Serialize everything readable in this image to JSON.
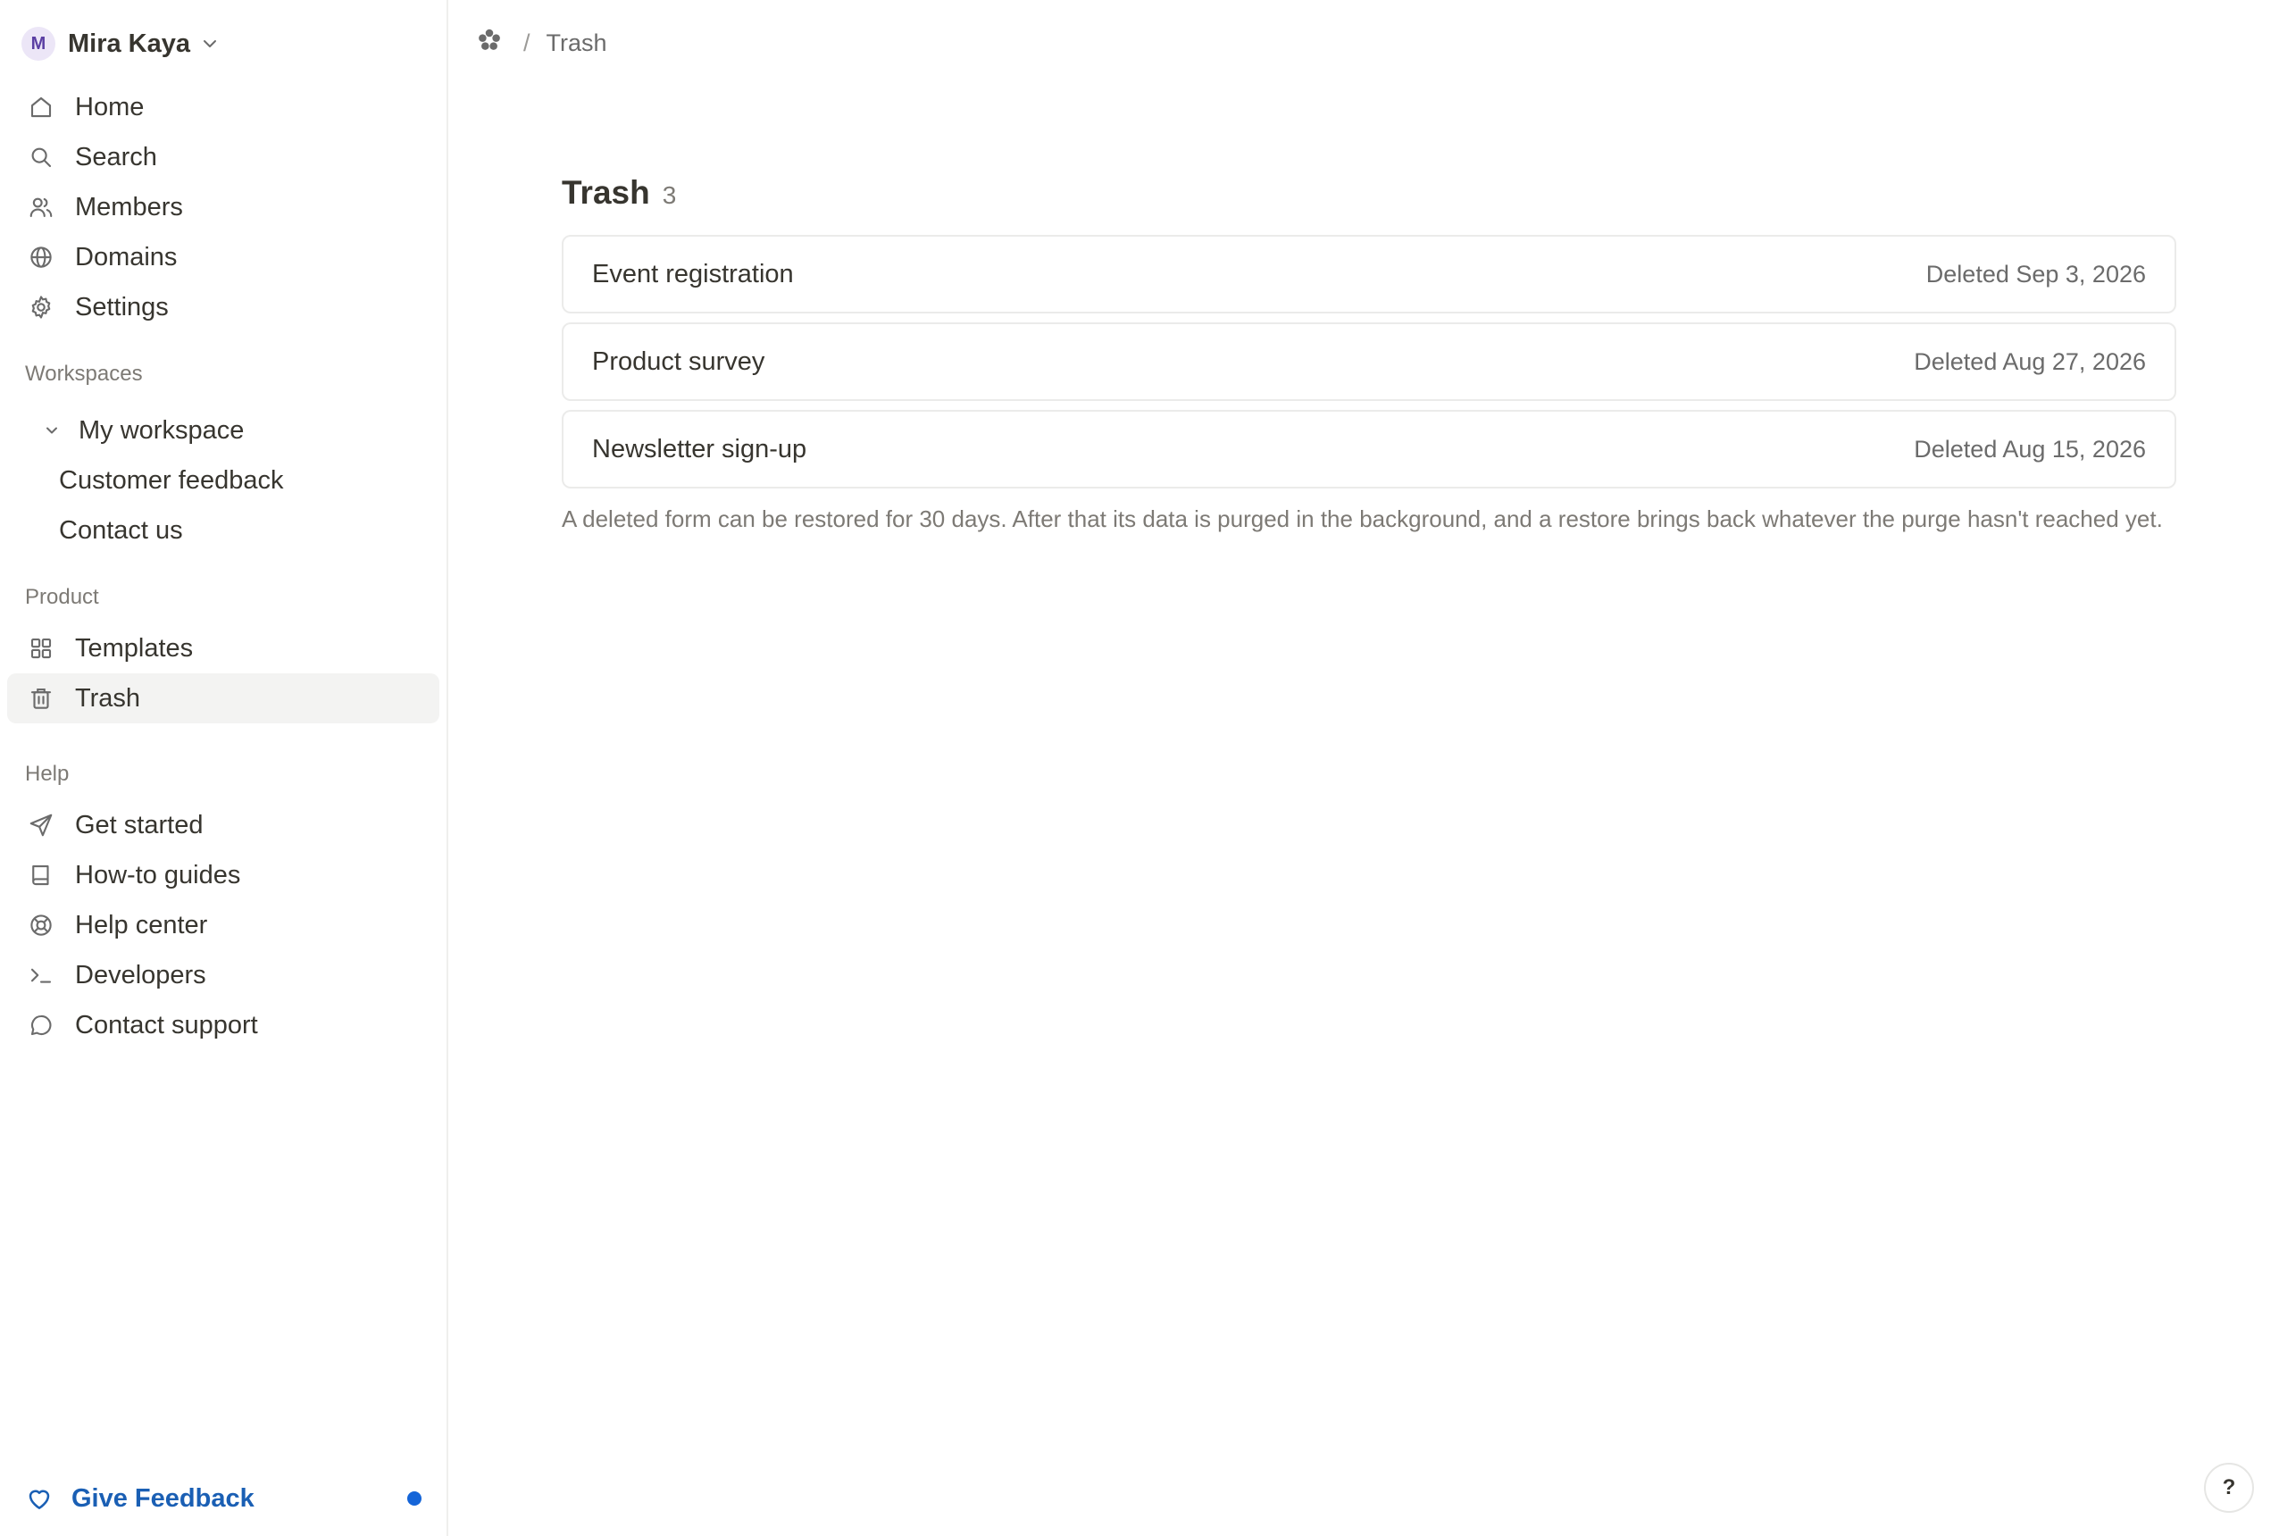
{
  "account": {
    "initial": "M",
    "name": "Mira Kaya"
  },
  "nav": [
    {
      "label": "Home",
      "icon": "home-icon"
    },
    {
      "label": "Search",
      "icon": "search-icon"
    },
    {
      "label": "Members",
      "icon": "members-icon"
    },
    {
      "label": "Domains",
      "icon": "globe-icon"
    },
    {
      "label": "Settings",
      "icon": "gear-icon"
    }
  ],
  "workspaces": {
    "section_label": "Workspaces",
    "workspace_name": "My workspace",
    "items": [
      "Customer feedback",
      "Contact us"
    ]
  },
  "product": {
    "section_label": "Product",
    "items": [
      {
        "label": "Templates",
        "icon": "grid-icon"
      },
      {
        "label": "Trash",
        "icon": "trash-icon"
      }
    ]
  },
  "help": {
    "section_label": "Help",
    "items": [
      {
        "label": "Get started",
        "icon": "send-icon"
      },
      {
        "label": "How-to guides",
        "icon": "book-icon"
      },
      {
        "label": "Help center",
        "icon": "lifebuoy-icon"
      },
      {
        "label": "Developers",
        "icon": "terminal-icon"
      },
      {
        "label": "Contact support",
        "icon": "chat-icon"
      }
    ]
  },
  "feedback": {
    "label": "Give Feedback",
    "color": "#1a5fb4"
  },
  "breadcrumb": {
    "separator": "/",
    "current": "Trash"
  },
  "trash": {
    "title": "Trash",
    "count": "3",
    "items": [
      {
        "name": "Event registration",
        "date": "Deleted Sep 3, 2026"
      },
      {
        "name": "Product survey",
        "date": "Deleted Aug 27, 2026"
      },
      {
        "name": "Newsletter sign-up",
        "date": "Deleted Aug 15, 2026"
      }
    ],
    "note": "A deleted form can be restored for 30 days. After that its data is purged in the background, and a restore brings back whatever the purge hasn't reached yet."
  },
  "help_button": {
    "label": "?"
  }
}
